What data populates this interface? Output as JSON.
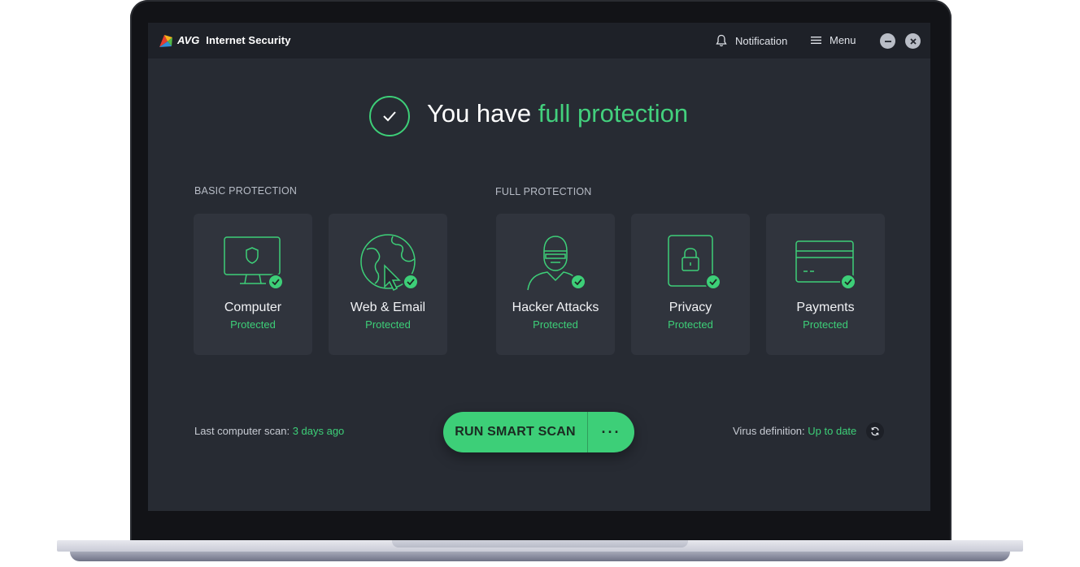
{
  "app": {
    "brand": "AVG",
    "title": "Internet Security"
  },
  "titlebar": {
    "notification_label": "Notification",
    "menu_label": "Menu"
  },
  "status": {
    "prefix": "You have",
    "highlight": "full protection"
  },
  "sections": {
    "basic_label": "BASIC PROTECTION",
    "full_label": "FULL PROTECTION"
  },
  "cards": [
    {
      "title": "Computer",
      "status": "Protected",
      "icon": "monitor-shield-icon"
    },
    {
      "title": "Web & Email",
      "status": "Protected",
      "icon": "globe-cursor-icon"
    },
    {
      "title": "Hacker Attacks",
      "status": "Protected",
      "icon": "hacker-icon"
    },
    {
      "title": "Privacy",
      "status": "Protected",
      "icon": "phone-lock-icon"
    },
    {
      "title": "Payments",
      "status": "Protected",
      "icon": "credit-card-icon"
    }
  ],
  "footer": {
    "last_scan_label": "Last computer scan:",
    "last_scan_value": "3 days ago",
    "scan_button": "RUN SMART SCAN",
    "more_button": "···",
    "virus_def_label": "Virus definition:",
    "virus_def_value": "Up to date"
  },
  "colors": {
    "accent": "#3dcf78",
    "background": "#272b33",
    "card": "#30343d",
    "titlebar": "#1e2128"
  }
}
